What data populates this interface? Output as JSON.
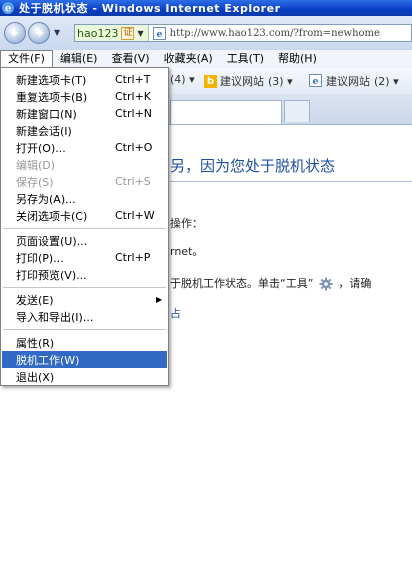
{
  "window": {
    "title": "处于脱机状态 - Windows Internet Explorer",
    "icon": "ie-icon"
  },
  "navbar": {
    "site_badge_text": "hao123",
    "cert_label": "证",
    "url": "http://www.hao123.com/?from=newhome"
  },
  "menubar": {
    "items": [
      {
        "label": "文件(F)"
      },
      {
        "label": "编辑(E)"
      },
      {
        "label": "查看(V)"
      },
      {
        "label": "收藏夹(A)"
      },
      {
        "label": "工具(T)"
      },
      {
        "label": "帮助(H)"
      }
    ]
  },
  "favorites": {
    "fav1_count": "(4) ▾",
    "fav2_label": "建议网站",
    "fav2_count": "(3) ▾",
    "fav3_label": "建议网站",
    "fav3_count": "(2) ▾"
  },
  "content": {
    "heading": "因为您处于脱机状态",
    "heading_prefix": "另，",
    "line1": "操作：",
    "line2": "rnet。",
    "line3_a": "于脱机工作状态。单击“工具”",
    "line3_b": "，请确",
    "blue_fragment": "占"
  },
  "file_menu": {
    "items": [
      {
        "label": "新建选项卡(T)",
        "shortcut": "Ctrl+T",
        "state": "normal"
      },
      {
        "label": "重复选项卡(B)",
        "shortcut": "Ctrl+K",
        "state": "normal"
      },
      {
        "label": "新建窗口(N)",
        "shortcut": "Ctrl+N",
        "state": "normal"
      },
      {
        "label": "新建会话(I)",
        "shortcut": "",
        "state": "normal"
      },
      {
        "label": "打开(O)...",
        "shortcut": "Ctrl+O",
        "state": "normal"
      },
      {
        "label": "编辑(D)",
        "shortcut": "",
        "state": "disabled"
      },
      {
        "label": "保存(S)",
        "shortcut": "Ctrl+S",
        "state": "disabled"
      },
      {
        "label": "另存为(A)...",
        "shortcut": "",
        "state": "normal"
      },
      {
        "label": "关闭选项卡(C)",
        "shortcut": "Ctrl+W",
        "state": "normal"
      },
      {
        "label": "页面设置(U)...",
        "shortcut": "",
        "state": "normal"
      },
      {
        "label": "打印(P)...",
        "shortcut": "Ctrl+P",
        "state": "normal"
      },
      {
        "label": "打印预览(V)...",
        "shortcut": "",
        "state": "normal"
      },
      {
        "label": "发送(E)",
        "shortcut": "",
        "state": "submenu"
      },
      {
        "label": "导入和导出(I)...",
        "shortcut": "",
        "state": "normal"
      },
      {
        "label": "属性(R)",
        "shortcut": "",
        "state": "normal"
      },
      {
        "label": "脱机工作(W)",
        "shortcut": "",
        "state": "selected"
      },
      {
        "label": "退出(X)",
        "shortcut": "",
        "state": "normal"
      }
    ]
  },
  "colors": {
    "titlebar": "#0a3fc4",
    "menu_highlight": "#316ac5",
    "heading_blue": "#1f4ea3",
    "disabled_text": "#9a9a9a"
  }
}
